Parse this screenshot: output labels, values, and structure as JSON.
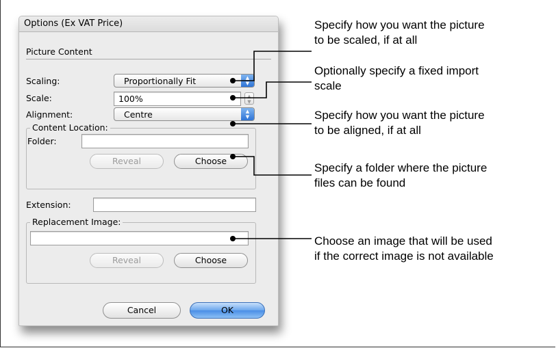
{
  "dialog": {
    "title": "Options (Ex VAT Price)",
    "section_title": "Picture Content",
    "scaling": {
      "label": "Scaling:",
      "value": "Proportionally Fit"
    },
    "scale": {
      "label": "Scale:",
      "value": "100%"
    },
    "alignment": {
      "label": "Alignment:",
      "value": "Centre"
    },
    "content_location": {
      "legend": "Content Location:",
      "folder_label": "Folder:",
      "folder_value": "",
      "reveal_label": "Reveal",
      "choose_label": "Choose"
    },
    "extension": {
      "label": "Extension:",
      "value": ""
    },
    "replacement_image": {
      "legend": "Replacement Image:",
      "value": "",
      "reveal_label": "Reveal",
      "choose_label": "Choose"
    },
    "cancel_label": "Cancel",
    "ok_label": "OK"
  },
  "annotations": {
    "scaling": [
      "Specify how you want the picture",
      "to be scaled, if at all"
    ],
    "scale": [
      "Optionally specify a fixed import",
      "scale"
    ],
    "alignment": [
      "Specify how you want the picture",
      "to be aligned, if at all"
    ],
    "folder": [
      "Specify a folder where the picture",
      "files can be found"
    ],
    "replacement": [
      "Choose an image that will be used",
      "if the correct image is not available"
    ]
  },
  "colors": {
    "accent_blue": "#4a8ee6",
    "dialog_bg": "#ececec"
  }
}
